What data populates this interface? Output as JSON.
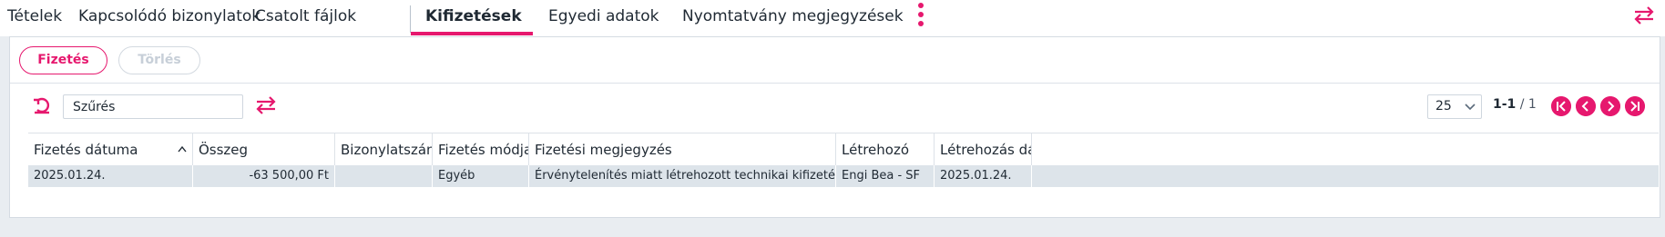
{
  "tabs": [
    {
      "label": "Tételek",
      "active": false
    },
    {
      "label": "Kapcsolódó bizonylatok",
      "active": false
    },
    {
      "label": "Csatolt fájlok",
      "active": false
    },
    {
      "label": "Kifizetések",
      "active": true
    },
    {
      "label": "Egyedi adatok",
      "active": false
    },
    {
      "label": "Nyomtatvány megjegyzések",
      "active": false
    }
  ],
  "actions": {
    "primary_label": "Fizetés",
    "secondary_label": "Törlés"
  },
  "filter": {
    "value": "Szűrés"
  },
  "pagination": {
    "page_size": "25",
    "range": "1-1",
    "separator": " / ",
    "total": "1"
  },
  "table": {
    "columns": [
      "Fizetés dátuma",
      "Összeg",
      "Bizonylatszám",
      "Fizetés módja",
      "Fizetési megjegyzés",
      "Létrehozó",
      "Létrehozás dátuma"
    ],
    "sorted_column": "Fizetés dátuma",
    "rows": [
      {
        "date": "2025.01.24.",
        "amount": "-63 500,00 Ft",
        "doc_number": "",
        "method": "Egyéb",
        "note": "Érvénytelenítés miatt létrehozott technikai kifizetés",
        "creator": "Engi Bea - SF",
        "created": "2025.01.24."
      }
    ]
  },
  "colors": {
    "accent": "#e6186e",
    "row_highlight": "#dde4ea",
    "background": "#e9edf1"
  },
  "icons": [
    "kebab-menu-icon",
    "swap-arrows-icon",
    "refresh-icon",
    "chevron-down-icon",
    "sort-ascending-icon",
    "first-page-icon",
    "previous-page-icon",
    "next-page-icon",
    "last-page-icon"
  ]
}
